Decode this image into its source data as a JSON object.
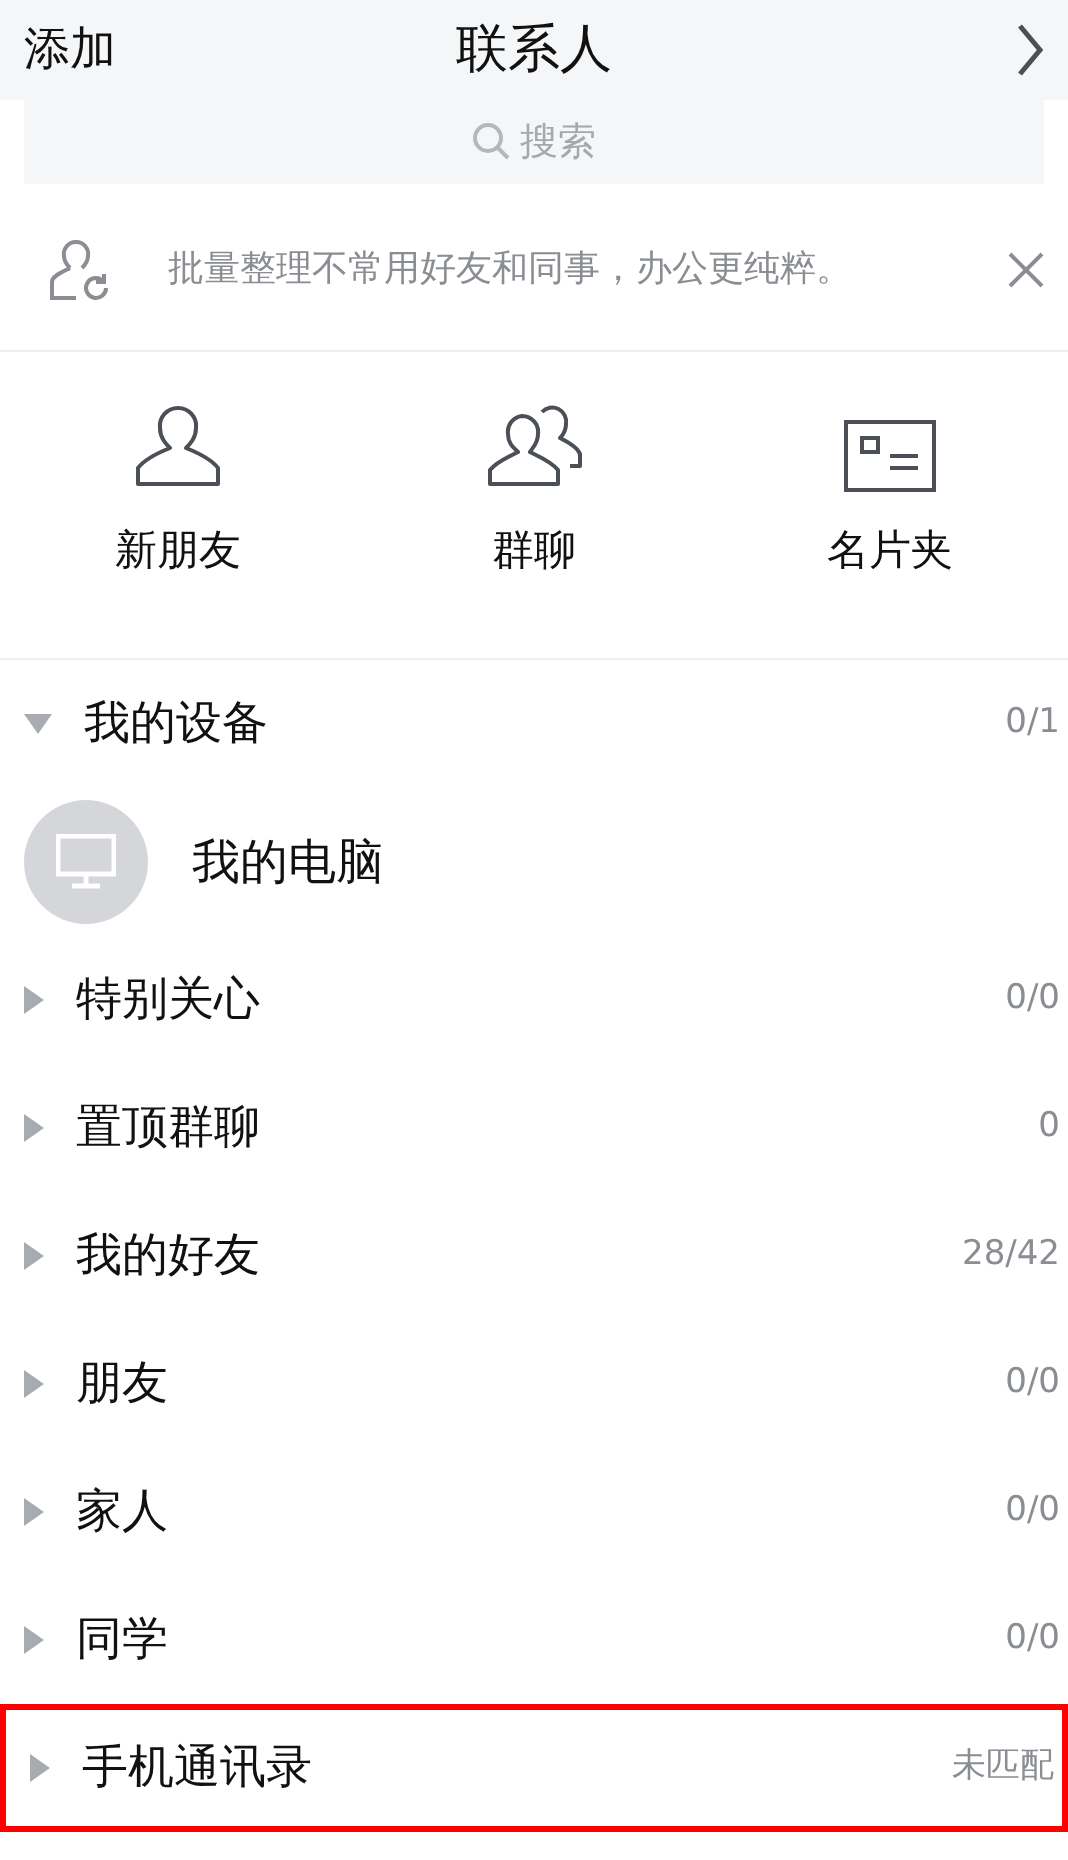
{
  "header": {
    "left": "添加",
    "title": "联系人"
  },
  "search": {
    "placeholder": "搜索"
  },
  "notice": {
    "text": "批量整理不常用好友和同事，办公更纯粹。"
  },
  "shortcuts": [
    {
      "kind": "person",
      "label": "新朋友"
    },
    {
      "kind": "group",
      "label": "群聊"
    },
    {
      "kind": "card",
      "label": "名片夹"
    }
  ],
  "groups": [
    {
      "name": "我的设备",
      "count": "0/1",
      "expanded": true,
      "highlighted": false,
      "children": [
        {
          "name": "我的电脑"
        }
      ]
    },
    {
      "name": "特别关心",
      "count": "0/0",
      "expanded": false,
      "highlighted": false
    },
    {
      "name": "置顶群聊",
      "count": "0",
      "expanded": false,
      "highlighted": false
    },
    {
      "name": "我的好友",
      "count": "28/42",
      "expanded": false,
      "highlighted": false
    },
    {
      "name": "朋友",
      "count": "0/0",
      "expanded": false,
      "highlighted": false
    },
    {
      "name": "家人",
      "count": "0/0",
      "expanded": false,
      "highlighted": false
    },
    {
      "name": "同学",
      "count": "0/0",
      "expanded": false,
      "highlighted": false
    },
    {
      "name": "手机通讯录",
      "count": "未匹配",
      "expanded": false,
      "highlighted": true
    }
  ]
}
